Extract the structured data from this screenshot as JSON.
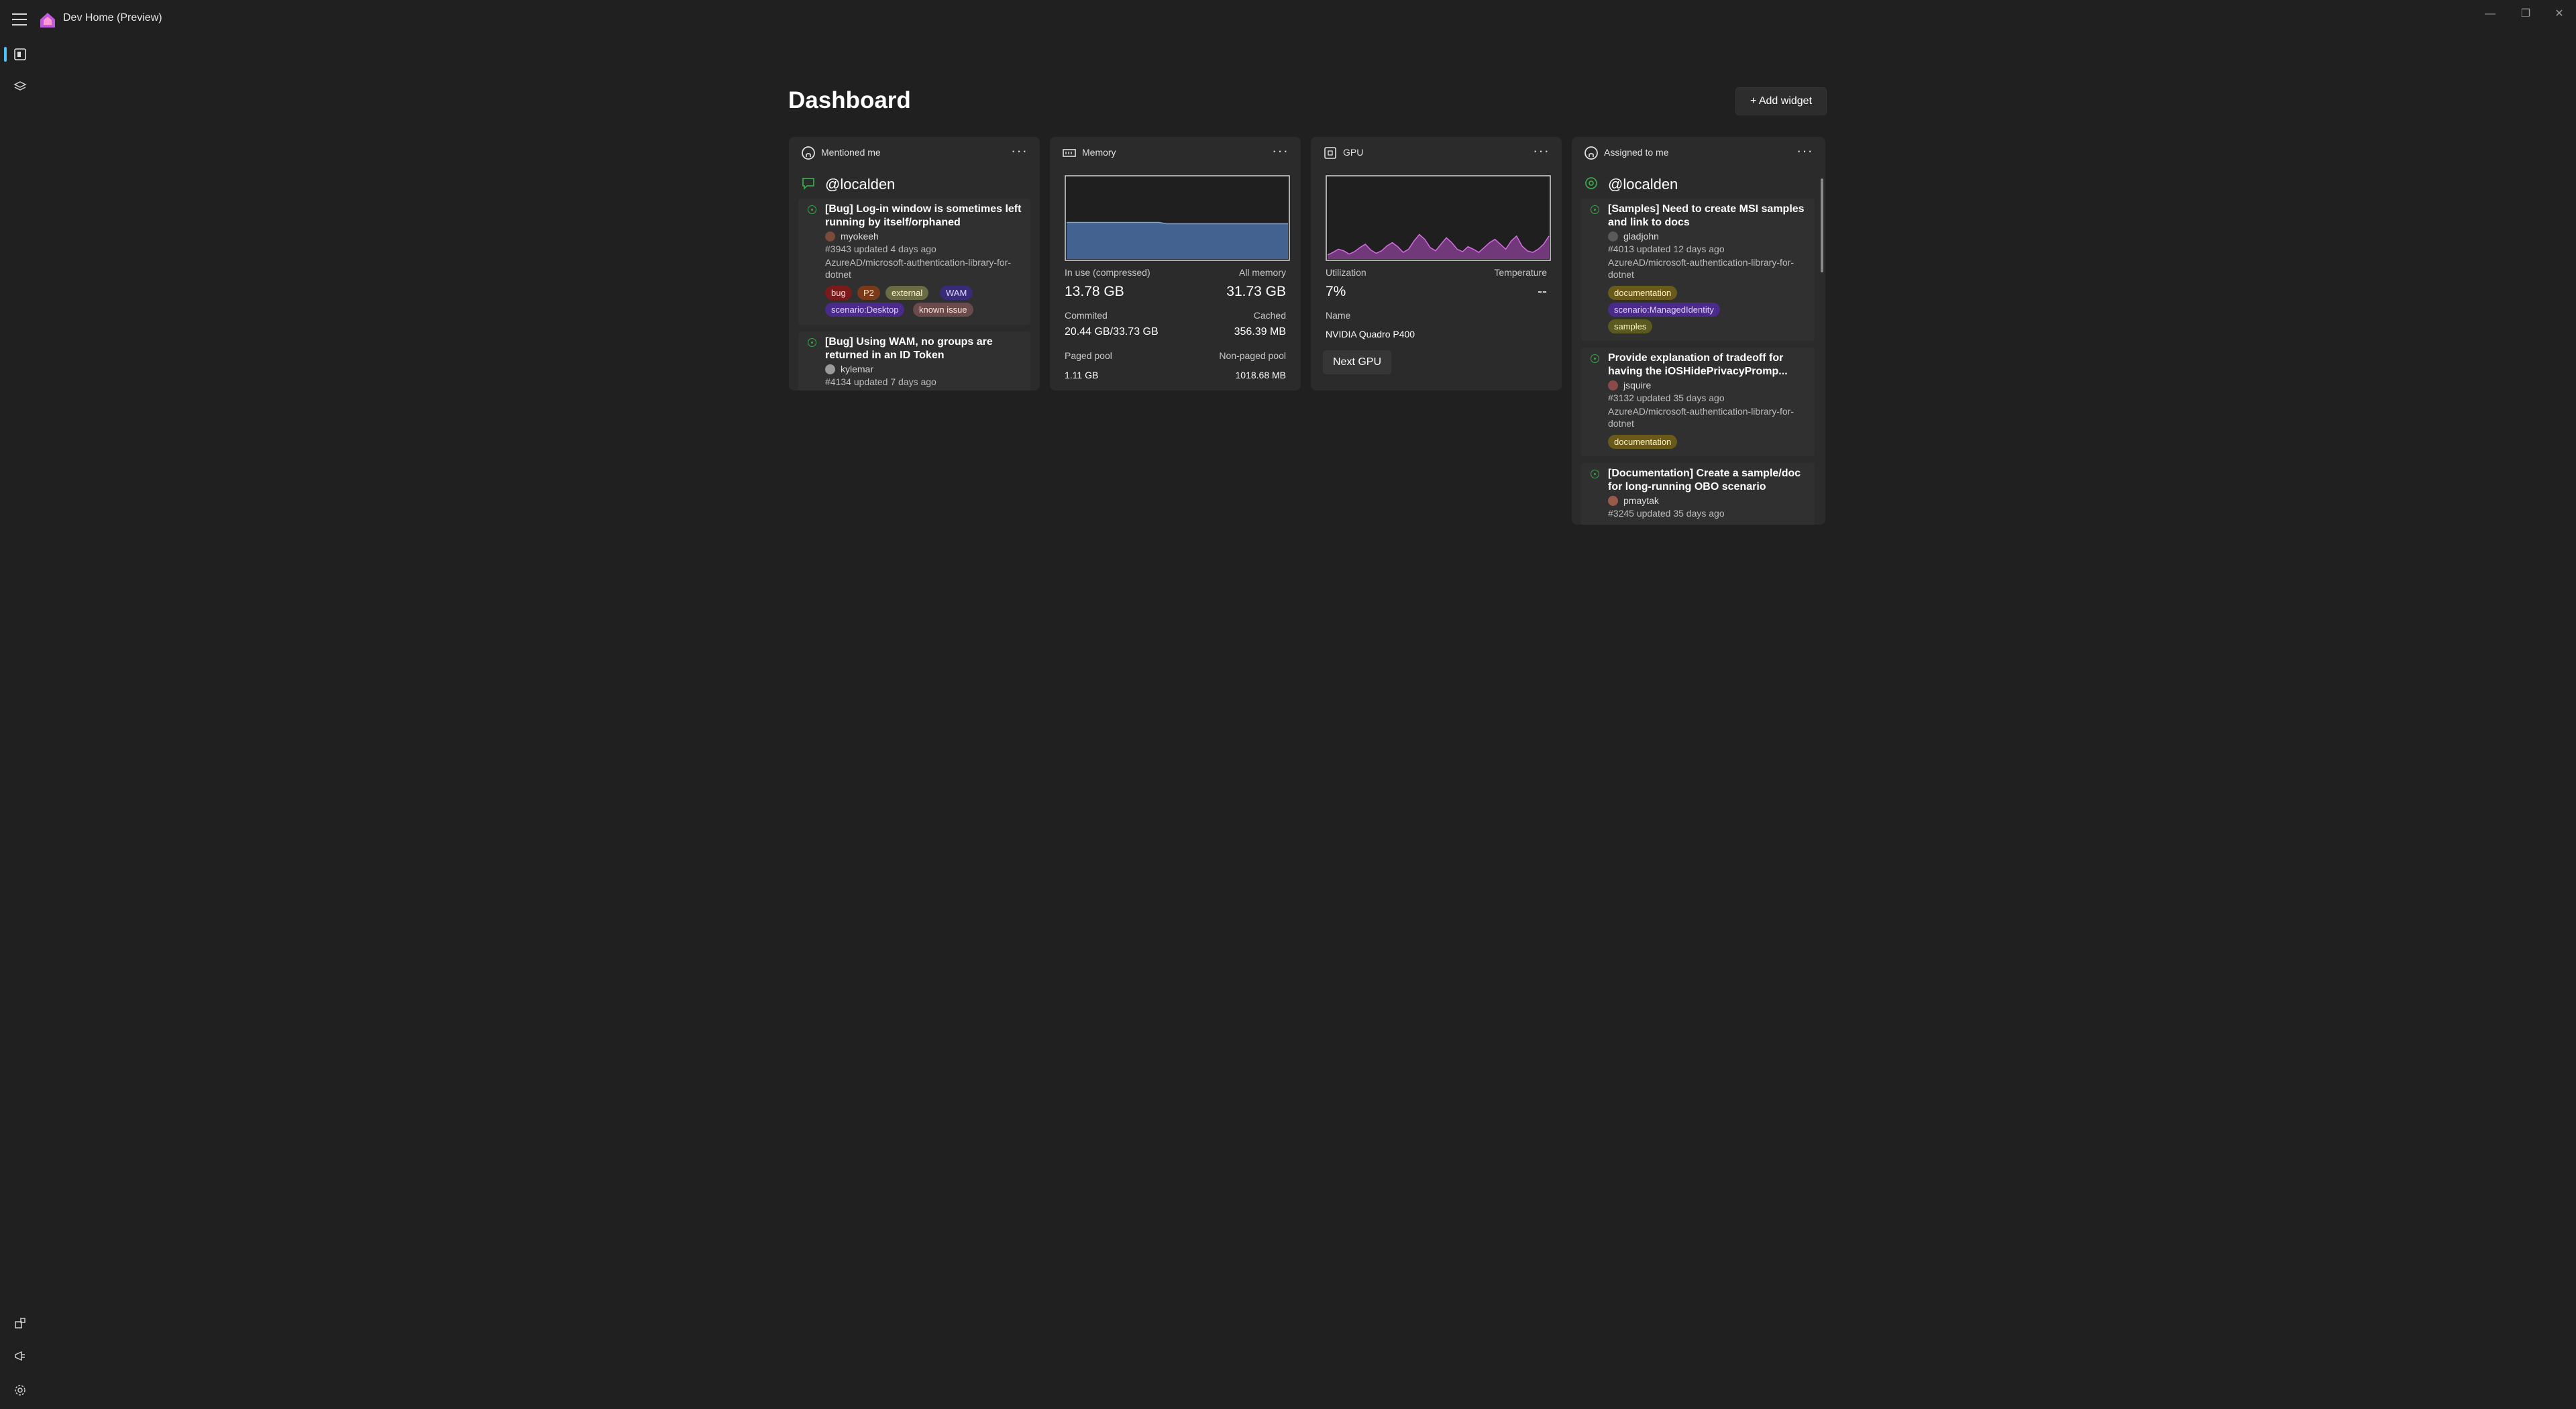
{
  "app": {
    "title": "Dev Home (Preview)"
  },
  "header": {
    "title": "Dashboard",
    "add_widget_label": "+ Add widget"
  },
  "colors": {
    "accent": "#4cc2ff",
    "memory_chart": "#4a6fa5",
    "gpu_chart": "#b44ec4",
    "issue_open": "#3aa54a"
  },
  "widgets": {
    "mentioned": {
      "title": "Mentioned me",
      "more": "···",
      "handle": "@localden",
      "items": [
        {
          "title": "[Bug] Log-in window is sometimes left running by itself/orphaned",
          "author": "myokeeh",
          "meta": "#3943 updated 4 days ago",
          "repo": "AzureAD/microsoft-authentication-library-for-dotnet",
          "labels": [
            "bug",
            "P2",
            "external",
            "WAM",
            "scenario:Desktop",
            "known issue"
          ]
        },
        {
          "title": "[Bug] Using WAM, no groups are returned in an ID Token",
          "author": "kylemar",
          "meta": "#4134 updated 7 days ago"
        }
      ]
    },
    "memory": {
      "title": "Memory",
      "more": "···",
      "in_use_label": "In use (compressed)",
      "in_use_value": "13.78 GB",
      "all_label": "All memory",
      "all_value": "31.73 GB",
      "committed_label": "Commited",
      "committed_value": "20.44 GB/33.73 GB",
      "cached_label": "Cached",
      "cached_value": "356.39 MB",
      "paged_label": "Paged pool",
      "paged_value": "1.11 GB",
      "nonpaged_label": "Non-paged pool",
      "nonpaged_value": "1018.68 MB",
      "usage_fraction": 0.43
    },
    "gpu": {
      "title": "GPU",
      "more": "···",
      "util_label": "Utilization",
      "util_value": "7%",
      "temp_label": "Temperature",
      "temp_value": "--",
      "name_label": "Name",
      "name_value": "NVIDIA Quadro P400",
      "next_label": "Next GPU",
      "history": [
        5,
        8,
        12,
        10,
        6,
        9,
        14,
        18,
        11,
        7,
        10,
        16,
        20,
        15,
        8,
        12,
        22,
        30,
        24,
        14,
        10,
        18,
        26,
        20,
        12,
        9,
        15,
        12,
        8,
        14,
        20,
        24,
        18,
        12,
        22,
        28,
        16,
        10,
        8,
        12,
        18,
        28
      ]
    },
    "assigned": {
      "title": "Assigned to me",
      "more": "···",
      "handle": "@localden",
      "items": [
        {
          "title": "[Samples] Need to create MSI samples and link to docs",
          "author": "gladjohn",
          "meta": "#4013 updated 12 days ago",
          "repo": "AzureAD/microsoft-authentication-library-for-dotnet",
          "labels": [
            "documentation",
            "scenario:ManagedIdentity",
            "samples"
          ]
        },
        {
          "title": "Provide explanation of tradeoff for having the iOSHidePrivacyPromp...",
          "author": "jsquire",
          "meta": "#3132 updated 35 days ago",
          "repo": "AzureAD/microsoft-authentication-library-for-dotnet",
          "labels": [
            "documentation"
          ]
        },
        {
          "title": "[Documentation] Create a sample/doc for long-running OBO scenario",
          "author": "pmaytak",
          "meta": "#3245 updated 35 days ago"
        }
      ]
    }
  }
}
